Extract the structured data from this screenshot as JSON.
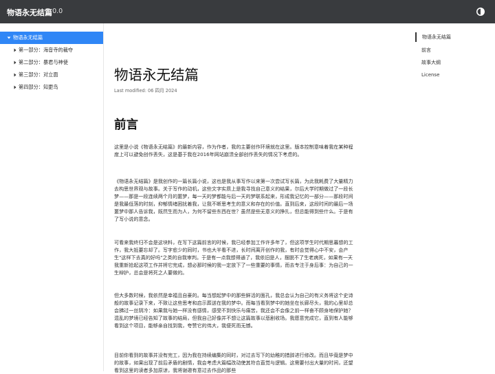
{
  "header": {
    "title": "物语永无结篇",
    "version": "1.0.0",
    "theme_icon": "contrast-icon"
  },
  "sidebar": {
    "items": [
      {
        "label": "物语永无结篇",
        "active": true,
        "expanded": true
      },
      {
        "label": "第一部分：海音寺的裁夺"
      },
      {
        "label": "第二部分：暴君与神使"
      },
      {
        "label": "第三部分：对立面"
      },
      {
        "label": "第四部分：知更鸟"
      }
    ]
  },
  "toc": {
    "items": [
      {
        "label": "物语永无结篇",
        "active": true
      },
      {
        "label": "前言"
      },
      {
        "label": "故事大纲"
      },
      {
        "label": "License"
      }
    ]
  },
  "main": {
    "title": "物语永无结篇",
    "last_modified": "Last modified: 06 四月 2024",
    "section_title": "前言",
    "paragraphs": [
      "这里是小说《物语永无结篇》的最新内容，作为作者，我的主要创作环境就在这里。版本控制意味着我在某种程度上可以避免创作丢失，这是基于我在2016年网站崩溃全部创作丢失的情况下考虑的。",
      "《物语永无结篇》是我创作的一篇长篇小说，这也是我从事写作以来第一次尝试写长篇，为此我耗费了大量精力去构思世界观与故事。关于写作的动机，这些文字实质上是我寻找自己意义的结果，尔后大学时期做过了一段长梦——那是一段连续两个月的噩梦，每一天的梦都能与后一天的梦联系起来，形成我记忆的一部分——那段时间是我最低落的时刻，抑郁情绪困扰着我，让我不断思考生的意义和存在的价值。直到后来，这段时间的最后一场噩梦中那人告诉我，既然生而为人，为何不留些东西在世？虽然是些无意义的挣扎，但总能得到些什么。于是有了写小说的意念。",
      "可看来我终归不会是这块料，在写下这篇前言的时候，我已经参加工作许多年了，但这项学生时代期思暮想的工作，我大抵要忘却了。写字愈少的同时，书也大半看不进，长时间离开创作的我，有时会觉得心中不安，会产生\"这样下去真的好吗\"之类的自我审判。于是有一点我想得通了，我依旧是人，摆脱不了生老病死，如果有一天我重新拾起这项工作并将它完成，想必那时候的我一定放下了一些重要的事情，而去专注于身后事：为自己的一生辩护，总会是将死之人要做的。",
      "但大多数时候，我依然是幸福且自豪的。每当想起梦中的那些鲜活的面孔，我总会认为自己的有义务将这个史诗般的故事记录下来，不致让这些思考和启示葬送在我的梦中。而每当看到梦中的她坐在长廊尽头，我的心里却总会拂过一丝阴冷：如果我与她一样没有感情，感受不到快乐与痛苦，我还会不会像之前一样奋不顾身地保护她？混乱的梦境已经告知了故事的结局，但我自己好像并不想让这篇故事以悲剧收场。我愿意完成它，直到有人能够看到这个项目，能够亲自找到我，夸赞它的伟大，我便死而无憾。",
      "目前你看到的故事并没有完工，因为我在持续编集的同时，对过去写下的幼稚的措辞进行修改。而且毕竟是梦中的故事，如果出现了前后矛盾的剧情，我会考虑大篇幅改动使其符合直觉与逻辑。这需要付出大量的时间，还望看到这里的读者多加原谅，我将谢邀有意过去作品的那些"
    ]
  }
}
